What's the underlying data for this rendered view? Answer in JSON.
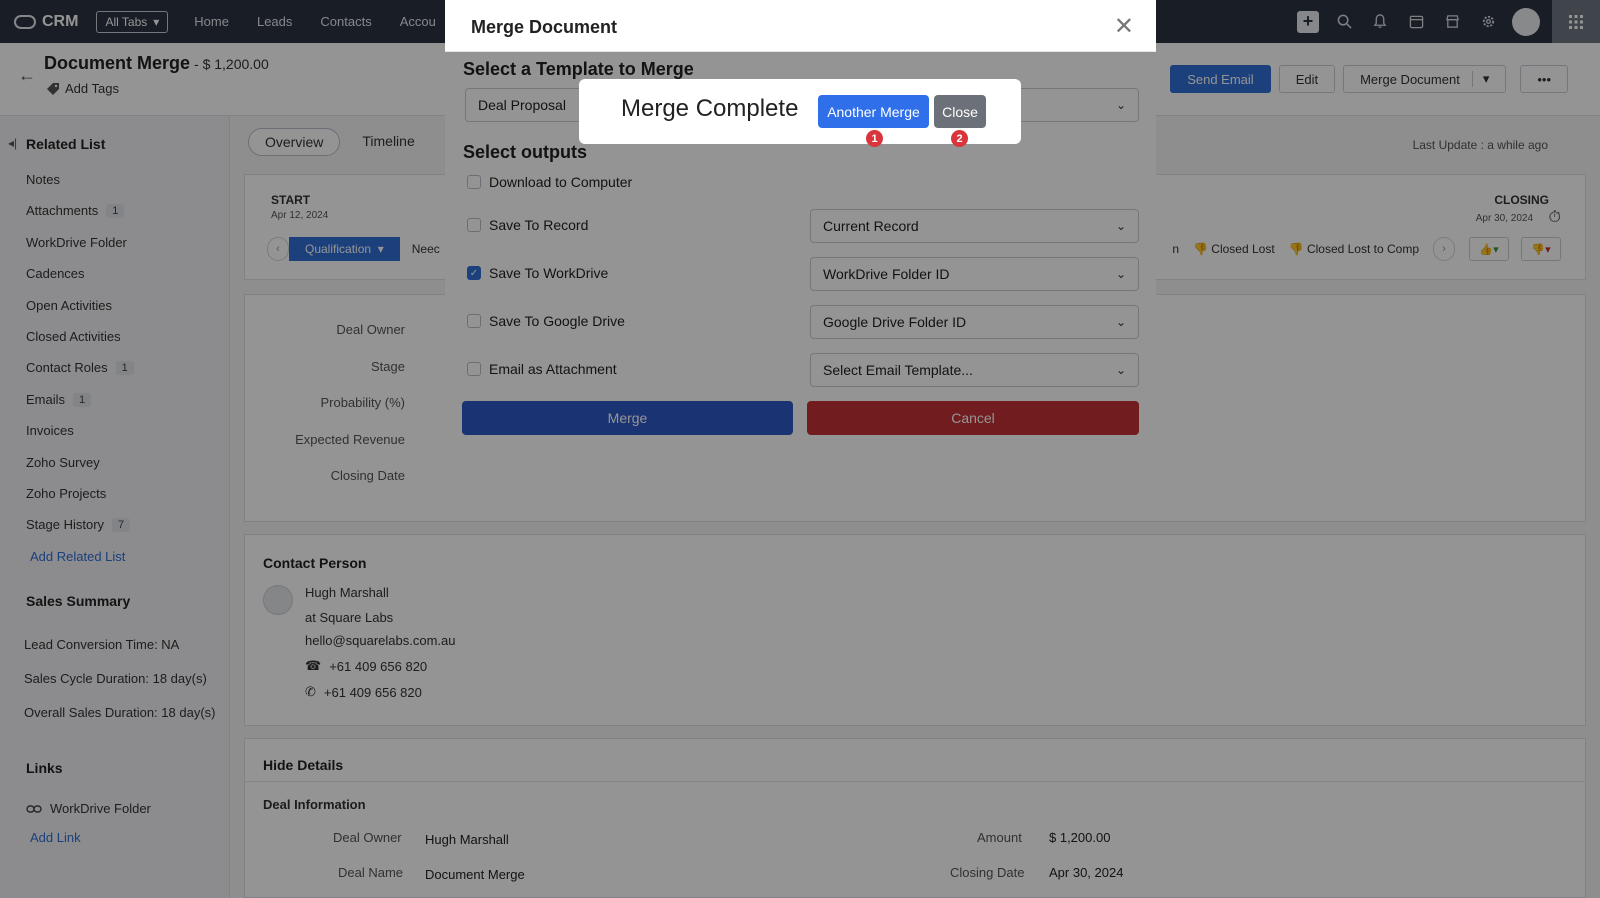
{
  "topnav": {
    "app_name": "CRM",
    "all_tabs": "All Tabs",
    "links": [
      "Home",
      "Leads",
      "Contacts",
      "Accou"
    ],
    "icons": [
      "plus-icon",
      "search-icon",
      "bell-icon",
      "calendar-icon",
      "store-icon",
      "gear-icon",
      "avatar",
      "grid-icon"
    ]
  },
  "header": {
    "title": "Document Merge",
    "amount": "- $ 1,200.00",
    "add_tags": "Add Tags",
    "buttons": {
      "send_email": "Send Email",
      "edit": "Edit",
      "merge_document": "Merge Document",
      "more": "•••"
    }
  },
  "sidebar": {
    "heading": "Related List",
    "items": [
      {
        "label": "Notes",
        "count": ""
      },
      {
        "label": "Attachments",
        "count": "1"
      },
      {
        "label": "WorkDrive Folder",
        "count": ""
      },
      {
        "label": "Cadences",
        "count": ""
      },
      {
        "label": "Open Activities",
        "count": ""
      },
      {
        "label": "Closed Activities",
        "count": ""
      },
      {
        "label": "Contact Roles",
        "count": "1"
      },
      {
        "label": "Emails",
        "count": "1"
      },
      {
        "label": "Invoices",
        "count": ""
      },
      {
        "label": "Zoho Survey",
        "count": ""
      },
      {
        "label": "Zoho Projects",
        "count": ""
      },
      {
        "label": "Stage History",
        "count": "7"
      }
    ],
    "add_related": "Add Related List",
    "sales_summary": "Sales Summary",
    "stats": [
      "Lead Conversion Time: NA",
      "Sales Cycle Duration: 18 day(s)",
      "Overall Sales Duration: 18 day(s)"
    ],
    "links_heading": "Links",
    "link_workdrive": "WorkDrive Folder",
    "add_link": "Add Link"
  },
  "main": {
    "tabs": [
      "Overview",
      "Timeline"
    ],
    "last_update": "Last Update : a while ago",
    "stage": {
      "start": "START",
      "start_date": "Apr 12, 2024",
      "closing": "CLOSING",
      "closing_date": "Apr 30, 2024",
      "active": "Qualification",
      "next": "Neec",
      "right_partial": "n",
      "closed_lost": "Closed Lost",
      "closed_lost_comp": "Closed Lost to Comp"
    },
    "field_labels": [
      "Deal Owner",
      "Stage",
      "Probability (%)",
      "Expected Revenue",
      "Closing Date"
    ],
    "contact": {
      "heading": "Contact Person",
      "name": "Hugh Marshall",
      "company": "at Square Labs",
      "email": "hello@squarelabs.com.au",
      "phone": "+61 409 656 820",
      "mobile": "+61 409 656 820"
    },
    "details": {
      "heading": "Hide Details",
      "sub": "Deal Information",
      "deal_owner_label": "Deal Owner",
      "deal_owner": "Hugh Marshall",
      "deal_name_label": "Deal Name",
      "deal_name": "Document Merge",
      "amount_label": "Amount",
      "amount": "$ 1,200.00",
      "closing_date_label": "Closing Date",
      "closing_date": "Apr 30, 2024"
    }
  },
  "merge_dialog": {
    "title": "Merge Document",
    "template_heading": "Select a Template to Merge",
    "template_value": "Deal Proposal",
    "outputs_heading": "Select outputs",
    "outputs": [
      {
        "label": "Download to Computer",
        "checked": false,
        "select": ""
      },
      {
        "label": "Save To Record",
        "checked": false,
        "select": "Current Record"
      },
      {
        "label": "Save To WorkDrive",
        "checked": true,
        "select": "WorkDrive Folder ID"
      },
      {
        "label": "Save To Google Drive",
        "checked": false,
        "select": "Google Drive Folder ID"
      },
      {
        "label": "Email as Attachment",
        "checked": false,
        "select": "Select Email Template..."
      }
    ],
    "merge_btn": "Merge",
    "cancel_btn": "Cancel"
  },
  "merge_complete": {
    "title": "Merge Complete",
    "another_btn": "Another Merge",
    "close_btn": "Close",
    "marker1": "1",
    "marker2": "2"
  }
}
